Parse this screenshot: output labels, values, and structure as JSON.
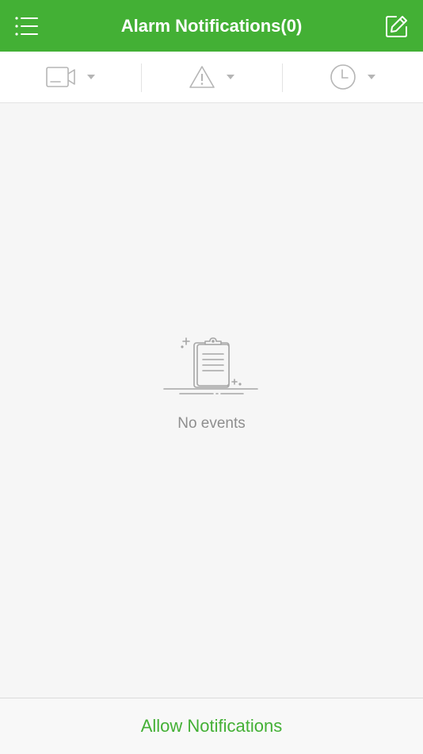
{
  "header": {
    "title": "Alarm Notifications(0)",
    "menu_icon": "menu-icon",
    "edit_icon": "edit-icon"
  },
  "filters": [
    {
      "icon": "camera-icon",
      "type": "device"
    },
    {
      "icon": "warning-icon",
      "type": "alarm-type"
    },
    {
      "icon": "clock-icon",
      "type": "time"
    }
  ],
  "empty_state": {
    "icon": "clipboard-icon",
    "message": "No events"
  },
  "footer": {
    "allow_label": "Allow Notifications"
  },
  "colors": {
    "brand_green": "#43b035",
    "background": "#f6f6f6",
    "icon_gray": "#b5b5b5",
    "text_gray": "#8e8e8e"
  }
}
